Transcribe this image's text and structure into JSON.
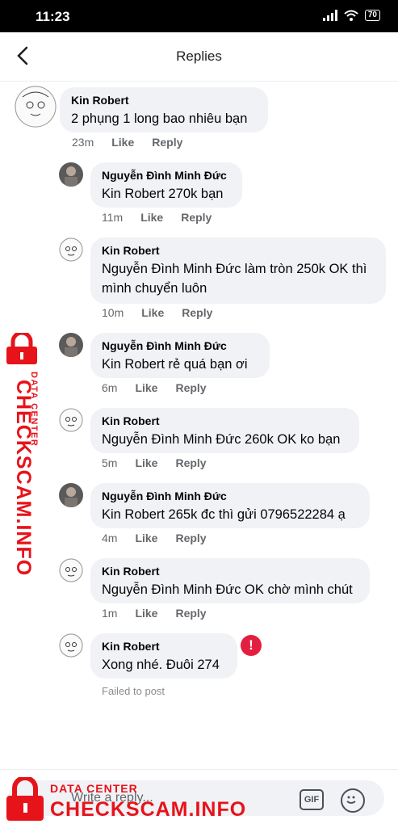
{
  "status_bar": {
    "time": "11:23",
    "battery": "70"
  },
  "header": {
    "title": "Replies"
  },
  "comments": [
    {
      "author": "Kin Robert",
      "text": "2 phụng 1 long bao nhiêu bạn",
      "time": "23m",
      "like": "Like",
      "reply": "Reply"
    },
    {
      "author": "Nguyễn Đình Minh Đức",
      "text": "Kin Robert 270k bạn",
      "time": "11m",
      "like": "Like",
      "reply": "Reply"
    },
    {
      "author": "Kin Robert",
      "text": "Nguyễn Đình Minh Đức làm tròn 250k OK thì mình chuyển luôn",
      "time": "10m",
      "like": "Like",
      "reply": "Reply"
    },
    {
      "author": "Nguyễn Đình Minh Đức",
      "text": "Kin Robert  rẻ quá bạn ơi",
      "time": "6m",
      "like": "Like",
      "reply": "Reply"
    },
    {
      "author": "Kin Robert",
      "text": "Nguyễn Đình Minh Đức 260k OK ko bạn",
      "time": "5m",
      "like": "Like",
      "reply": "Reply"
    },
    {
      "author": "Nguyễn Đình Minh Đức",
      "text": "Kin Robert 265k đc thì gửi 0796522284 ạ",
      "time": "4m",
      "like": "Like",
      "reply": "Reply"
    },
    {
      "author": "Kin Robert",
      "text": "Nguyễn Đình Minh Đức OK chờ mình chút",
      "time": "1m",
      "like": "Like",
      "reply": "Reply"
    },
    {
      "author": "Kin Robert",
      "text": "Xong nhé. Đuôi 274",
      "status": "Failed to post",
      "error_badge": "!"
    }
  ],
  "composer": {
    "placeholder": "Write a reply...",
    "gif": "GIF"
  },
  "watermark": {
    "line1": "DATA CENTER",
    "line2": "CHECKSCAM.INFO"
  },
  "colors": {
    "watermark": "#e7131a",
    "error": "#e41e3f",
    "bubble": "#f0f2f5"
  },
  "icons": [
    "back-arrow-icon",
    "signal-icon",
    "wifi-icon",
    "battery-icon",
    "error-icon",
    "gif-icon",
    "emoji-icon",
    "lock-icon"
  ]
}
